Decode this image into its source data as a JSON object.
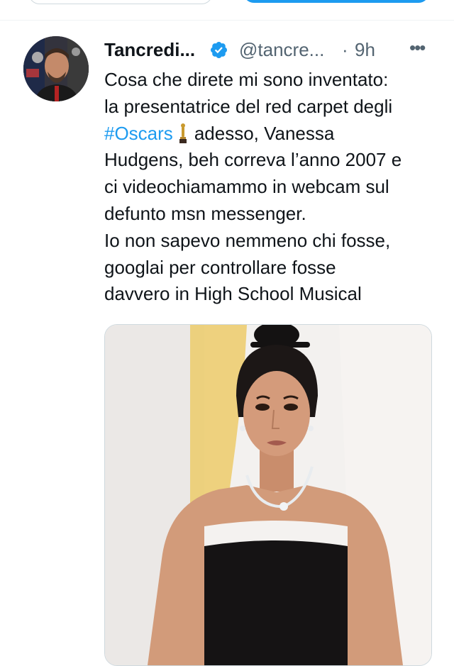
{
  "tweet": {
    "author_name": "Tancredi...",
    "author_handle": "@tancre...",
    "dot": "·",
    "time": "9h",
    "more_label": "•••",
    "text_lines": [
      "Cosa che direte mi sono inventato:",
      "la presentatrice del red carpet degli",
      "adesso, Vanessa",
      "Hudgens, beh correva l’anno 2007 e",
      "ci videochiamammo in webcam sul",
      "defunto msn messenger.",
      "Io non sapevo nemmeno chi fosse,",
      "googlai per controllare fosse",
      "davvero in High School Musical"
    ],
    "hashtag": "#Oscars",
    "emoji": "oscar-statuette-icon",
    "media_alt_icon": "photo"
  },
  "colors": {
    "accent": "#1d9bf0",
    "text": "#0f1419",
    "secondary": "#536471",
    "border": "#cfd9de"
  }
}
